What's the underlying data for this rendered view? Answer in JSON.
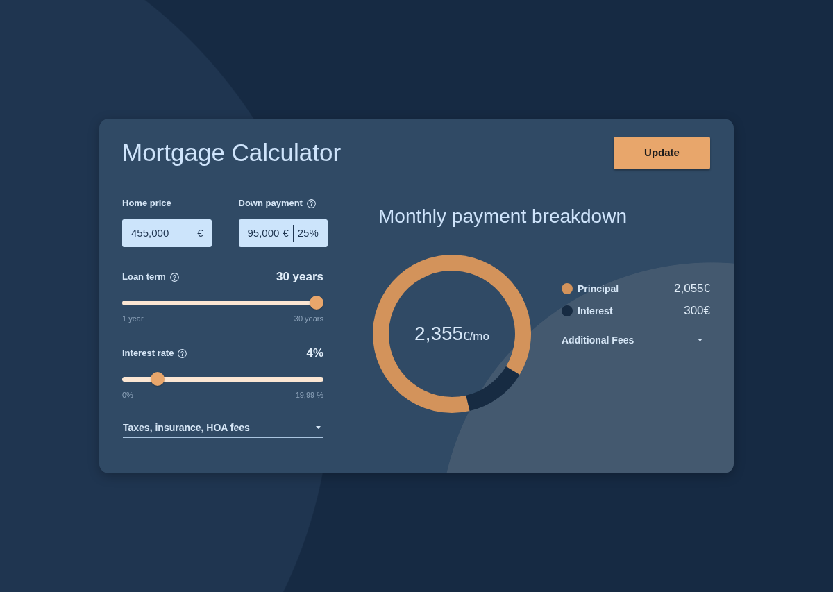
{
  "header": {
    "title": "Mortgage Calculator",
    "button": "Update"
  },
  "inputs": [
    {
      "label": "Home price",
      "help": false,
      "value": "455,000",
      "unit": "€"
    },
    {
      "label": "Down payment",
      "help": true,
      "value": "95,000",
      "unit": "€",
      "percent": "25%"
    }
  ],
  "sliders": [
    {
      "label": "Loan term",
      "help": true,
      "reading": "30 years",
      "level": 1,
      "min_label": "1 year",
      "max_label": "30 years"
    },
    {
      "label": "Interest rate",
      "help": true,
      "reading": "4%",
      "level": 0.15,
      "min_label": "0%",
      "max_label": "19,99 %"
    }
  ],
  "fees_dropdown": {
    "label": "Taxes, insurance, HOA fees"
  },
  "breakdown": {
    "title": "Monthly payment breakdown",
    "total": "2,355",
    "total_unit": "€/mo",
    "chart_data": {
      "type": "donut",
      "categories": [
        "Principal",
        "Interest"
      ],
      "values": [
        87.26,
        12.74
      ]
    },
    "legend": [
      {
        "amount": "2,055€",
        "color": "#d3935b"
      },
      {
        "amount": "300€",
        "color": "#172b42"
      }
    ],
    "fees_dropdown": {
      "label": "Additional Fees"
    }
  }
}
